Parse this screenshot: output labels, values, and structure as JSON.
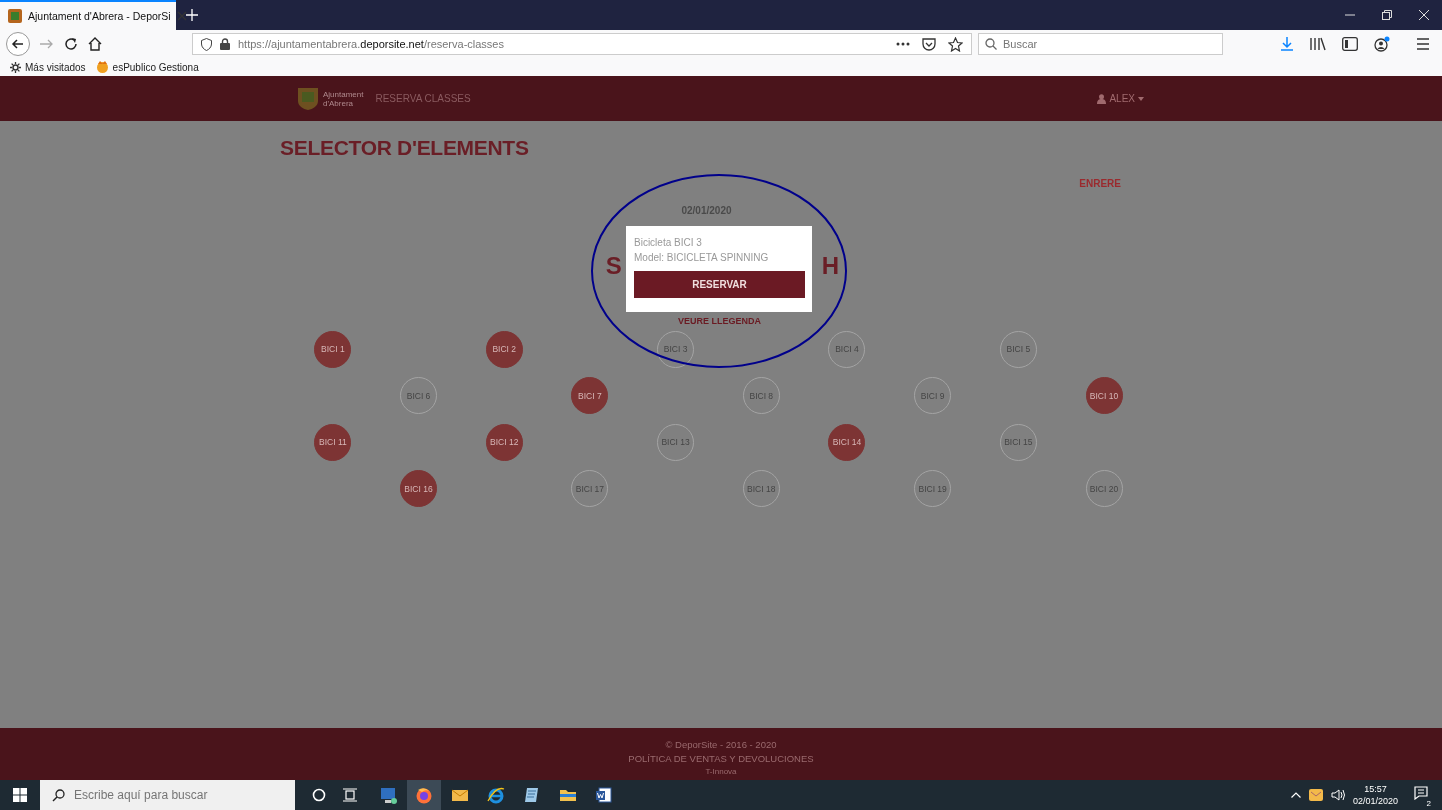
{
  "browser": {
    "tab": {
      "title": "Ajuntament d'Abrera - DeporSi",
      "selected": true
    },
    "address": {
      "url": "https://ajuntamentabrera.**deporsite.net**/reserva-classes"
    },
    "search": {
      "placeholder": "Buscar"
    },
    "bookmarks": [
      {
        "label": "Más visitados",
        "kind": "folder"
      },
      {
        "label": "esPublico Gestiona",
        "kind": "site"
      }
    ]
  },
  "site_header": {
    "logo_lines": [
      "Ajuntament",
      "d'Abrera"
    ],
    "nav_link": "RESERVA CLASSES",
    "user": "ALEX"
  },
  "page": {
    "title": "SELECTOR D'ELEMENTS",
    "back_link": "ENRERE",
    "date": "02/01/2020",
    "heading_fragments": [
      "S",
      "H"
    ],
    "legend_link": "VEURE LLEGENDA",
    "bikes": [
      {
        "label": "BICI 1",
        "reserved": true
      },
      {
        "label": "BICI 2",
        "reserved": true
      },
      {
        "label": "BICI 3",
        "reserved": false
      },
      {
        "label": "BICI 4",
        "reserved": false
      },
      {
        "label": "BICI 5",
        "reserved": false
      },
      {
        "label": "BICI 6",
        "reserved": false
      },
      {
        "label": "BICI 7",
        "reserved": true
      },
      {
        "label": "BICI 8",
        "reserved": false
      },
      {
        "label": "BICI 9",
        "reserved": false
      },
      {
        "label": "BICI 10",
        "reserved": true
      },
      {
        "label": "BICI 11",
        "reserved": true
      },
      {
        "label": "BICI 12",
        "reserved": true
      },
      {
        "label": "BICI 13",
        "reserved": false
      },
      {
        "label": "BICI 14",
        "reserved": true
      },
      {
        "label": "BICI 15",
        "reserved": false
      },
      {
        "label": "BICI 16",
        "reserved": true
      },
      {
        "label": "BICI 17",
        "reserved": false
      },
      {
        "label": "BICI 18",
        "reserved": false
      },
      {
        "label": "BICI 19",
        "reserved": false
      },
      {
        "label": "BICI 20",
        "reserved": false
      }
    ]
  },
  "popup": {
    "lines": [
      "Bicicleta BICI 3",
      "Model: BICICLETA SPINNING"
    ],
    "button": "RESERVAR"
  },
  "footer": {
    "lines": [
      "© DeporSite - 2016 - 2020",
      "POLÍTICA DE VENTAS Y DEVOLUCIONES",
      "T-Innova"
    ]
  },
  "taskbar": {
    "search_placeholder": "Escribe aquí para buscar",
    "apps": [
      {
        "kind": "computer",
        "selected": false
      },
      {
        "kind": "firefox",
        "selected": true
      },
      {
        "kind": "mail",
        "selected": false
      },
      {
        "kind": "ie",
        "selected": false
      },
      {
        "kind": "notepad",
        "selected": false
      },
      {
        "kind": "folder",
        "selected": false
      },
      {
        "kind": "word",
        "selected": false
      }
    ],
    "time": "15:57",
    "date": "02/01/2020",
    "notifications": "2"
  }
}
